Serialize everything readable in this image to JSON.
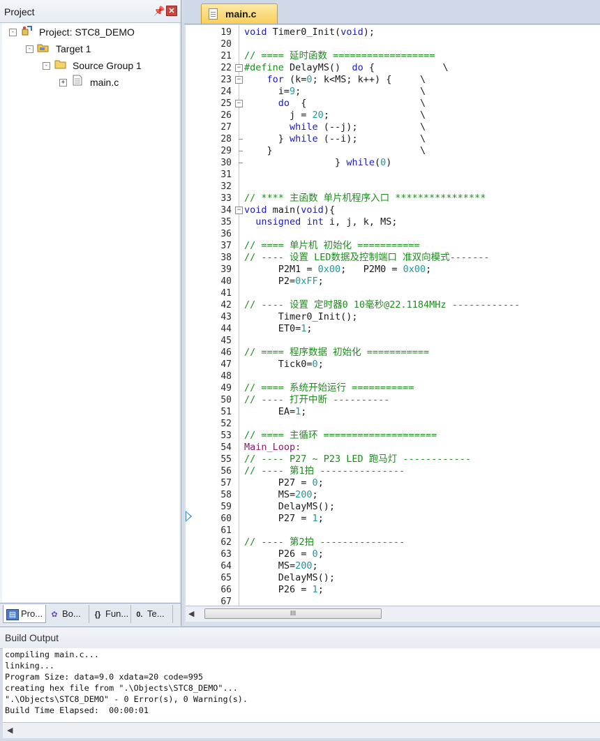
{
  "project_panel": {
    "title": "Project",
    "tree": [
      {
        "label": "Project: STC8_DEMO",
        "icon": "project-icon",
        "expander": "-"
      },
      {
        "label": "Target 1",
        "icon": "target-icon",
        "expander": "-"
      },
      {
        "label": "Source Group 1",
        "icon": "folder-icon",
        "expander": "-"
      },
      {
        "label": "main.c",
        "icon": "file-icon",
        "expander": "+"
      }
    ],
    "tabs": [
      {
        "label": "Pro...",
        "icon": "project-tab-icon"
      },
      {
        "label": "Bo...",
        "icon": "books-icon"
      },
      {
        "label": "Fun...",
        "icon": "functions-icon"
      },
      {
        "label": "Te...",
        "icon": "templates-icon"
      }
    ]
  },
  "editor": {
    "tab_label": "main.c",
    "lines": [
      {
        "n": "19",
        "t": "void Timer0_Init(void);"
      },
      {
        "n": "20",
        "t": ""
      },
      {
        "n": "21",
        "t": "// ==== 延时函数 =================="
      },
      {
        "n": "22",
        "t": "#define DelayMS()  do {            \\"
      },
      {
        "n": "23",
        "t": "    for (k=0; k<MS; k++) {     \\"
      },
      {
        "n": "24",
        "t": "      i=9;                     \\"
      },
      {
        "n": "25",
        "t": "      do  {                    \\"
      },
      {
        "n": "26",
        "t": "        j = 20;                \\"
      },
      {
        "n": "27",
        "t": "        while (--j);           \\"
      },
      {
        "n": "28",
        "t": "      } while (--i);           \\"
      },
      {
        "n": "29",
        "t": "    }                          \\"
      },
      {
        "n": "30",
        "t": "                } while(0)"
      },
      {
        "n": "31",
        "t": ""
      },
      {
        "n": "32",
        "t": ""
      },
      {
        "n": "33",
        "t": "// **** 主函数 单片机程序入口 ****************"
      },
      {
        "n": "34",
        "t": "void main(void){"
      },
      {
        "n": "35",
        "t": "  unsigned int i, j, k, MS;"
      },
      {
        "n": "36",
        "t": ""
      },
      {
        "n": "37",
        "t": "// ==== 单片机 初始化 ==========="
      },
      {
        "n": "38",
        "t": "// ---- 设置 LED数据及控制端口 准双向模式-------"
      },
      {
        "n": "39",
        "t": "      P2M1 = 0x00;   P2M0 = 0x00;"
      },
      {
        "n": "40",
        "t": "      P2=0xFF;"
      },
      {
        "n": "41",
        "t": ""
      },
      {
        "n": "42",
        "t": "// ---- 设置 定时器0 10毫秒@22.1184MHz ------------"
      },
      {
        "n": "43",
        "t": "      Timer0_Init();"
      },
      {
        "n": "44",
        "t": "      ET0=1;"
      },
      {
        "n": "45",
        "t": ""
      },
      {
        "n": "46",
        "t": "// ==== 程序数据 初始化 ==========="
      },
      {
        "n": "47",
        "t": "      Tick0=0;"
      },
      {
        "n": "48",
        "t": ""
      },
      {
        "n": "49",
        "t": "// ==== 系统开始运行 ==========="
      },
      {
        "n": "50",
        "t": "// ---- 打开中断 ----------"
      },
      {
        "n": "51",
        "t": "      EA=1;"
      },
      {
        "n": "52",
        "t": ""
      },
      {
        "n": "53",
        "t": "// ==== 主循环 ===================="
      },
      {
        "n": "54",
        "t": "Main_Loop:"
      },
      {
        "n": "55",
        "t": "// ---- P27 ~ P23 LED 跑马灯 ------------"
      },
      {
        "n": "56",
        "t": "// ---- 第1拍 ---------------"
      },
      {
        "n": "57",
        "t": "      P27 = 0;"
      },
      {
        "n": "58",
        "t": "      MS=200;"
      },
      {
        "n": "59",
        "t": "      DelayMS();"
      },
      {
        "n": "60",
        "t": "      P27 = 1;"
      },
      {
        "n": "61",
        "t": ""
      },
      {
        "n": "62",
        "t": "// ---- 第2拍 ---------------"
      },
      {
        "n": "63",
        "t": "      P26 = 0;"
      },
      {
        "n": "64",
        "t": "      MS=200;"
      },
      {
        "n": "65",
        "t": "      DelayMS();"
      },
      {
        "n": "66",
        "t": "      P26 = 1;"
      },
      {
        "n": "67",
        "t": ""
      }
    ],
    "scrollbar_grip": "III"
  },
  "build_output": {
    "title": "Build Output",
    "lines": [
      "compiling main.c...",
      "linking...",
      "Program Size: data=9.0 xdata=20 code=995",
      "creating hex file from \".\\Objects\\STC8_DEMO\"...",
      "\".\\Objects\\STC8_DEMO\" - 0 Error(s), 0 Warning(s).",
      "Build Time Elapsed:  00:00:01"
    ]
  }
}
